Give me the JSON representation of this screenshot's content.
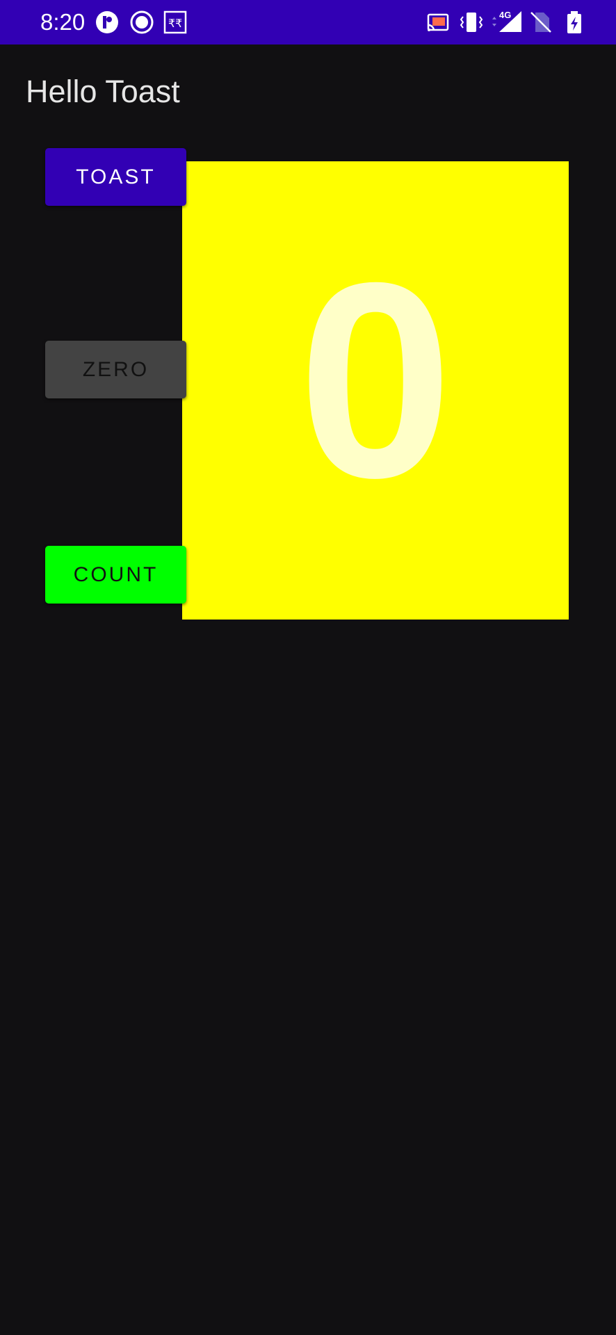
{
  "status_bar": {
    "time": "8:20",
    "network_label": "4G",
    "background_color": "#3200b4",
    "icons": [
      "notification-badge-icon",
      "record-icon",
      "rupee-icon",
      "cast-icon",
      "vibrate-icon",
      "signal-icon",
      "no-sim-icon",
      "battery-charging-icon"
    ]
  },
  "app_bar": {
    "title": "Hello Toast"
  },
  "buttons": {
    "toast_label": "TOAST",
    "zero_label": "ZERO",
    "count_label": "COUNT"
  },
  "counter": {
    "value": "0",
    "panel_color": "#ffff00"
  },
  "colors": {
    "background": "#111012",
    "toast_button": "#3200b4",
    "zero_button": "#434343",
    "count_button": "#00ff00"
  }
}
